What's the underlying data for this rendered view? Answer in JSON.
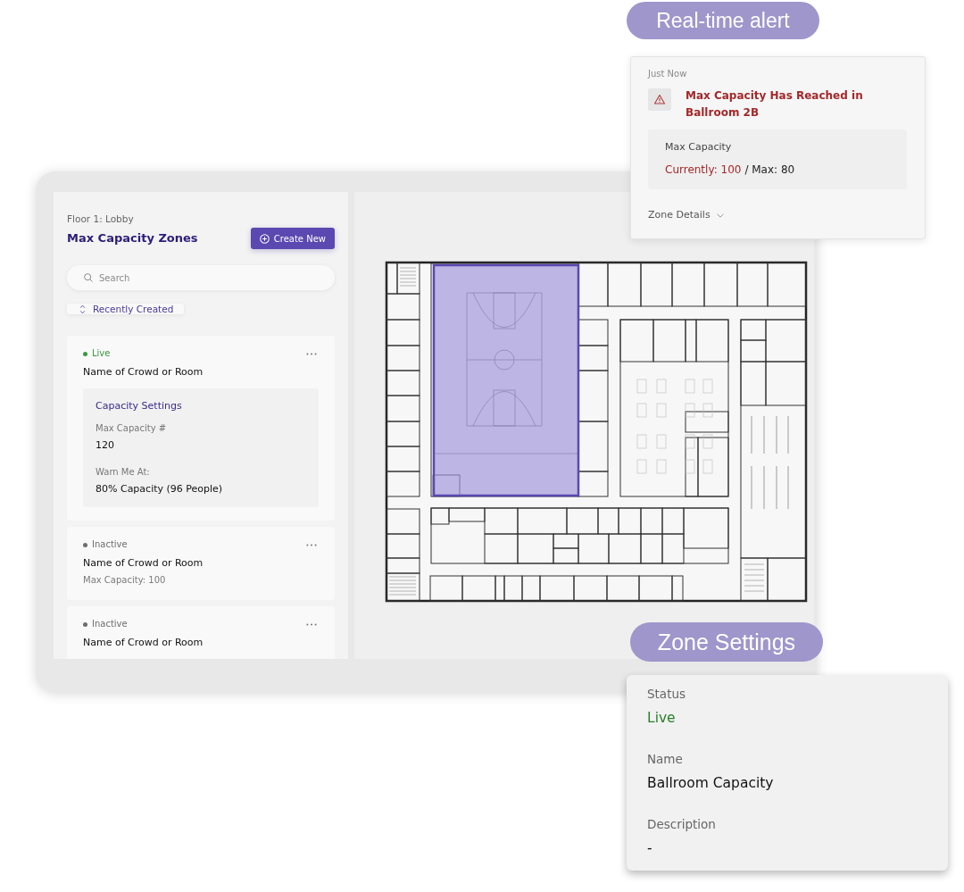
{
  "alert": {
    "label": "Real-time alert",
    "time": "Just Now",
    "title": "Max Capacity Has Reached in Ballroom 2B",
    "metric": {
      "label": "Max Capacity",
      "current": "Currently: 100",
      "limit": "/ Max: 80"
    },
    "details_toggle": "Zone Details"
  },
  "sidebar": {
    "floor": "Floor 1: Lobby",
    "title": "Max Capacity Zones",
    "create_button": "Create New",
    "search": {
      "placeholder": "Search"
    },
    "sort_button": "Recently Created",
    "zones": [
      {
        "status": "Live",
        "color": "#3a9a3e",
        "name": "Name of Crowd or Room",
        "settings": {
          "title": "Capacity Settings",
          "fields": [
            {
              "label": "Max Capacity #",
              "value": "120"
            },
            {
              "label": "Warn Me At:",
              "value": "80% Capacity (96 People)"
            }
          ]
        }
      },
      {
        "status": "Inactive",
        "color": "#6e6e6e",
        "name": "Name of Crowd or Room",
        "summary": "Max Capacity: 100"
      },
      {
        "status": "Inactive",
        "color": "#6e6e6e",
        "name": "Name of Crowd or Room"
      }
    ]
  },
  "map": {
    "zone_highlighted": true
  },
  "zone_settings": {
    "label": "Zone Settings",
    "fields": [
      {
        "label": "Status",
        "value": "Live",
        "kind": "status"
      },
      {
        "label": "Name",
        "value": "Ballroom Capacity",
        "kind": "text"
      },
      {
        "label": "Description",
        "value": "-",
        "kind": "text"
      }
    ]
  }
}
